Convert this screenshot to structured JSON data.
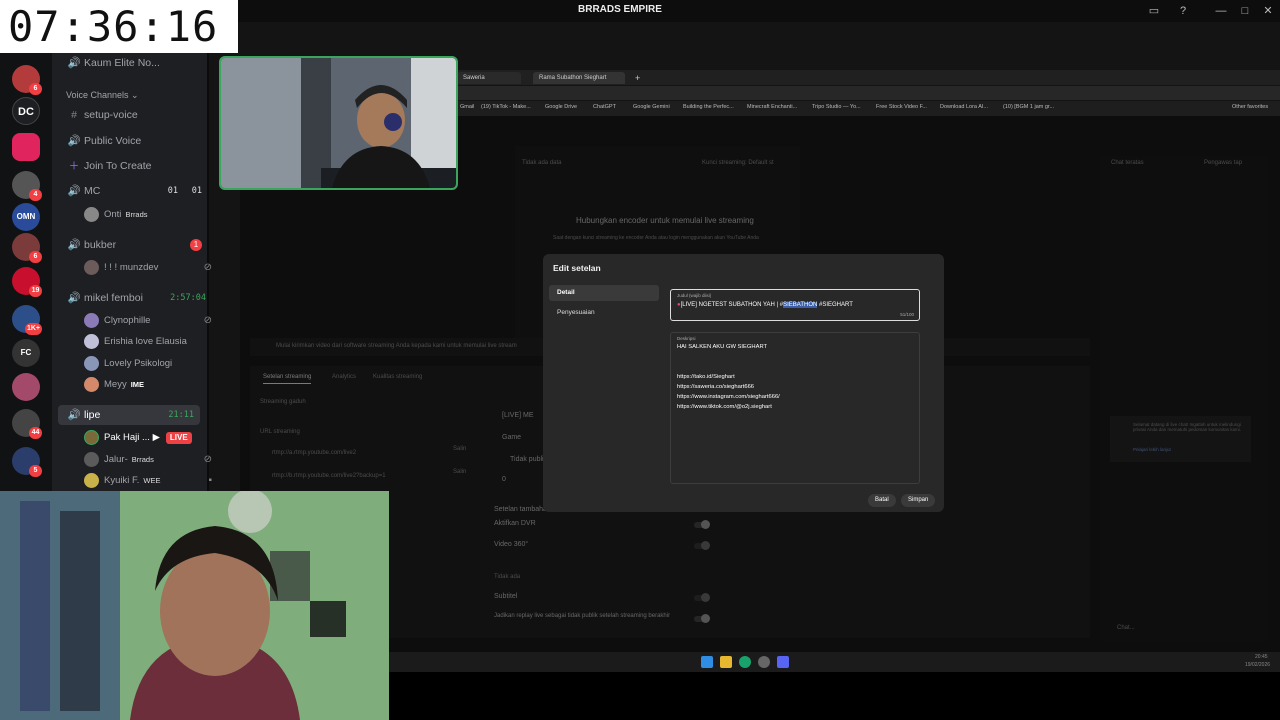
{
  "clock": "07:36:16",
  "window_title": "BRRADS EMPIRE",
  "discord": {
    "server_labels": [
      "DC",
      "OMN",
      "FC"
    ],
    "server_badges": [
      "6",
      "4",
      "6",
      "19",
      "1K+",
      "44",
      "5"
    ],
    "channels": {
      "top_item": "Kaum Elite No...",
      "category": "Voice Channels",
      "setup_voice": "setup-voice",
      "public_voice": "Public Voice",
      "join_to_create": "Join To Create",
      "mc": "MC",
      "mc_count_a": "01",
      "mc_count_b": "01",
      "mc_user": "Onti",
      "mc_user_tag": "Brrads",
      "bukber": "bukber",
      "bukber_badge": "1",
      "bukber_user": "! ! ! munzdev",
      "mikel_femboi": "mikel femboi",
      "mikel_timer": "2:57:04",
      "mikel_users": [
        "Clynophille",
        "Erishia love Elausia",
        "Lovely Psikologi",
        "Meyy"
      ],
      "meyy_tag": "IME",
      "lipe": "lipe",
      "lipe_timer": "21:11",
      "lipe_users": [
        "Pak Haji ...",
        "Jalur-",
        "Kyuiki F."
      ],
      "lipe_user_tags": [
        "",
        "Brrads",
        "WEE"
      ],
      "live_badge": "LIVE"
    }
  },
  "browser": {
    "tabs": [
      "Saweria",
      "Rama Subathon Sieghart"
    ],
    "bookmarks": [
      "Gmail",
      "(19) TikTok - Make...",
      "Google Drive",
      "ChatGPT",
      "Google Gemini",
      "Building the Perfec...",
      "Minecraft Enchanti...",
      "Tripo Studio — Yo...",
      "Free Stock Video F...",
      "Download Lora AI...",
      "(10) [BGM 1 jam gr...",
      "Other favorites"
    ]
  },
  "studio": {
    "no_data": "Tidak ada data",
    "stream_key": "Kunci streaming: Default st",
    "connect_encoder": "Hubungkan encoder untuk memulai live streaming",
    "connect_sub": "Saat dengan kunci streaming ke encoder Anda atau login menggunakan akun YouTube Anda",
    "start_sending": "Mulai kirimkan video dari software streaming Anda kepada kami untuk memulai live stream",
    "tabs": [
      "Setelan streaming",
      "Analytics",
      "Kualitas streaming"
    ],
    "stream_key_label": "Streaming gaduh",
    "url_label": "URL streaming",
    "url1": "rtmp://a.rtmp.youtube.com/live2",
    "url2": "rtmp://b.rtmp.youtube.com/live2?backup=1",
    "copy": "Salin",
    "title_preview": "[LIVE] ME",
    "category": "Game",
    "privacy": "Tidak publi",
    "viewers": "0",
    "extra_settings": "Setelan tambahan",
    "dvr": "Aktifkan DVR",
    "video360": "Video 360°",
    "subtitle_none": "Tidak ada",
    "subtitle": "Subtitel",
    "replay_private": "Jadikan replay live sebagai tidak publik setelah streaming berakhir",
    "chat_header": "Chat teratas",
    "chat_member": "Pengawas tap",
    "chat_welcome": "Selamat datang di live chat! Ingatlah untuk melindungi privasi Anda dan mematuhi pedoman komunitas kami.",
    "chat_learn": "Pelajari lebih lanjut",
    "chat_placeholder": "Chat..."
  },
  "modal": {
    "title": "Edit setelan",
    "nav": [
      "Detail",
      "Penyesuaian"
    ],
    "title_label": "Judul (wajib diisi)",
    "title_prefix": "[LIVE] NGETEST SUBATHON YAH | #",
    "title_highlight": "SIEBATHON",
    "title_suffix": " #SIEGHART",
    "title_count": "51/100",
    "desc_label": "Deskripsi",
    "desc_lines": [
      "HAI SALKEN AKU GW SIEGHART",
      "",
      "",
      "https://tako.id/Sieghart",
      "https://saweria.co/sieghart666",
      "https://www.instagram.com/sieghart666/",
      "https://www.tiktok.com/@o2j.sieghart"
    ],
    "cancel": "Batal",
    "save": "Simpan"
  },
  "taskbar": {
    "time": "20:45",
    "date": "19/02/2026"
  }
}
